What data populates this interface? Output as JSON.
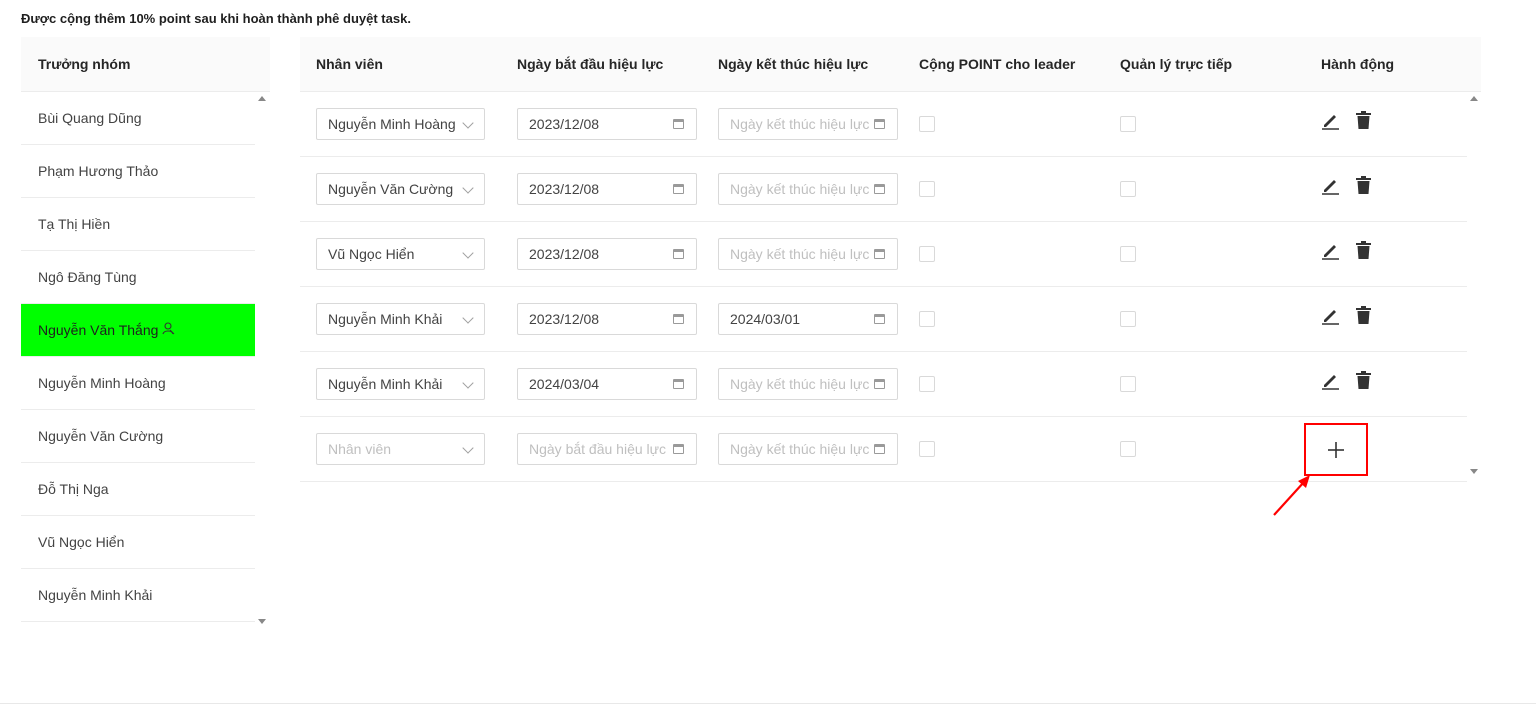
{
  "notice": "Được cộng thêm 10% point sau khi hoàn thành phê duyệt task.",
  "leaders": {
    "header": "Trưởng nhóm",
    "items": [
      {
        "name": "Bùi Quang Dũng",
        "active": false
      },
      {
        "name": "Phạm Hương Thảo",
        "active": false
      },
      {
        "name": "Tạ Thị Hiền",
        "active": false
      },
      {
        "name": "Ngô Đăng Tùng",
        "active": false
      },
      {
        "name": "Nguyễn Văn Thắng",
        "active": true,
        "badge_icon": "user-badge-icon"
      },
      {
        "name": "Nguyễn Minh Hoàng",
        "active": false
      },
      {
        "name": "Nguyễn Văn Cường",
        "active": false
      },
      {
        "name": "Đỗ Thị Nga",
        "active": false
      },
      {
        "name": "Vũ Ngọc Hiển",
        "active": false
      },
      {
        "name": "Nguyễn Minh Khải",
        "active": false
      }
    ],
    "active_color": "#00ff00"
  },
  "table": {
    "columns": [
      "Nhân viên",
      "Ngày bắt đầu hiệu lực",
      "Ngày kết thúc hiệu lực",
      "Cộng POINT cho leader",
      "Quản lý trực tiếp",
      "Hành động"
    ],
    "rows": [
      {
        "employee": "Nguyễn Minh Hoàng",
        "start": "2023/12/08",
        "end": "",
        "leader_point": false,
        "direct_manager": false
      },
      {
        "employee": "Nguyễn Văn Cường",
        "start": "2023/12/08",
        "end": "",
        "leader_point": false,
        "direct_manager": false
      },
      {
        "employee": "Vũ Ngọc Hiển",
        "start": "2023/12/08",
        "end": "",
        "leader_point": false,
        "direct_manager": false
      },
      {
        "employee": "Nguyễn Minh Khải",
        "start": "2023/12/08",
        "end": "2024/03/01",
        "leader_point": false,
        "direct_manager": false
      },
      {
        "employee": "Nguyễn Minh Khải",
        "start": "2024/03/04",
        "end": "",
        "leader_point": false,
        "direct_manager": false
      }
    ],
    "new_row": {
      "employee_placeholder": "Nhân viên",
      "start_placeholder": "Ngày bắt đầu hiệu lực",
      "end_placeholder": "Ngày kết thúc hiệu lực"
    },
    "end_placeholder": "Ngày kết thúc hiệu lực",
    "actions": {
      "edit_icon": "pencil-icon",
      "delete_icon": "trash-icon",
      "add_icon": "plus-icon"
    }
  },
  "annotation": {
    "highlight_color": "#ff0000",
    "arrow_icon": "red-arrow-icon"
  }
}
